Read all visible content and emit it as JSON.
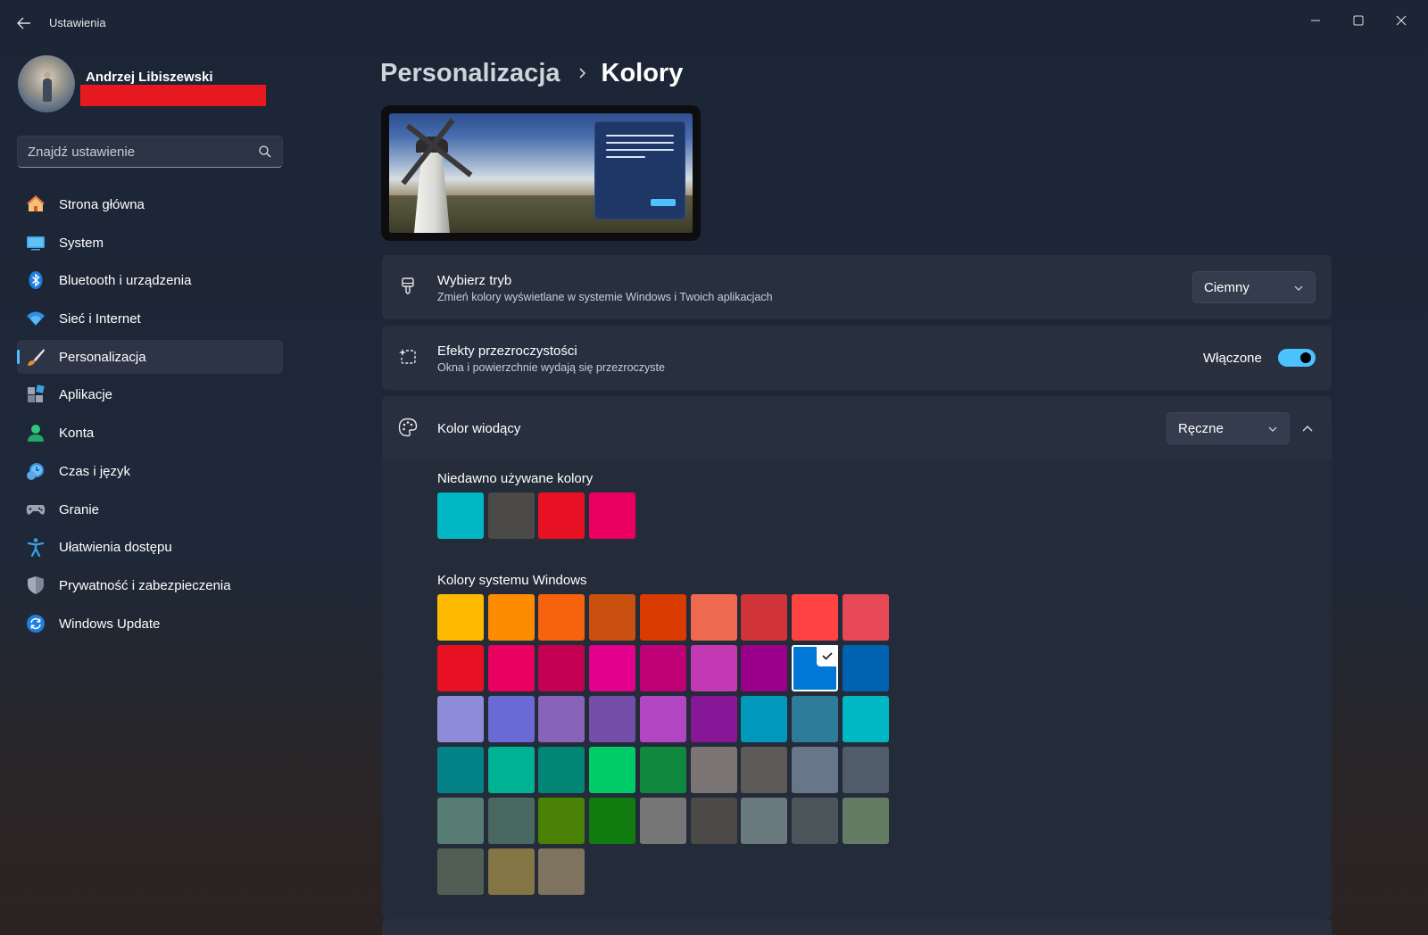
{
  "app": {
    "title": "Ustawienia"
  },
  "profile": {
    "name": "Andrzej Libiszewski"
  },
  "search": {
    "placeholder": "Znajdź ustawienie"
  },
  "nav": [
    {
      "label": "Strona główna",
      "icon": "home-icon"
    },
    {
      "label": "System",
      "icon": "monitor-icon"
    },
    {
      "label": "Bluetooth i urządzenia",
      "icon": "bluetooth-icon"
    },
    {
      "label": "Sieć i Internet",
      "icon": "wifi-icon"
    },
    {
      "label": "Personalizacja",
      "icon": "brush-icon",
      "active": true
    },
    {
      "label": "Aplikacje",
      "icon": "apps-icon"
    },
    {
      "label": "Konta",
      "icon": "person-icon"
    },
    {
      "label": "Czas i język",
      "icon": "clock-globe-icon"
    },
    {
      "label": "Granie",
      "icon": "gamepad-icon"
    },
    {
      "label": "Ułatwienia dostępu",
      "icon": "accessibility-icon"
    },
    {
      "label": "Prywatność i zabezpieczenia",
      "icon": "shield-icon"
    },
    {
      "label": "Windows Update",
      "icon": "update-icon"
    }
  ],
  "breadcrumb": {
    "parent": "Personalizacja",
    "current": "Kolory"
  },
  "mode": {
    "title": "Wybierz tryb",
    "subtitle": "Zmień kolory wyświetlane w systemie Windows i Twoich aplikacjach",
    "value": "Ciemny"
  },
  "transparency": {
    "title": "Efekty przezroczystości",
    "subtitle": "Okna i powierzchnie wydają się przezroczyste",
    "state_label": "Włączone",
    "on": true
  },
  "accent": {
    "title": "Kolor wiodący",
    "value": "Ręczne",
    "recent_title": "Niedawno używane kolory",
    "recent_colors": [
      "#00b7c3",
      "#4c4a48",
      "#e81123",
      "#ea005e"
    ],
    "system_title": "Kolory systemu Windows",
    "selected_color": "#0078d7",
    "system_colors": [
      [
        "#ffb900",
        "#ff8c00",
        "#f7630c",
        "#ca5010",
        "#da3b01",
        "#ef6950",
        "#d13438",
        "#ff4343",
        "#e74856"
      ],
      [
        "#e81123",
        "#ea005e",
        "#c30052",
        "#e3008c",
        "#bf0077",
        "#c239b3",
        "#9a0089",
        "#0078d7",
        "#0063b1"
      ],
      [
        "#8e8cd8",
        "#6b69d6",
        "#8764b8",
        "#744da9",
        "#b146c2",
        "#881798",
        "#0099bc",
        "#2d7d9a",
        "#00b7c3"
      ],
      [
        "#038387",
        "#00b294",
        "#018574",
        "#00cc6a",
        "#10893e",
        "#7a7574",
        "#5d5a58",
        "#68768a",
        "#515c6b"
      ],
      [
        "#567c73",
        "#486860",
        "#498205",
        "#107c10",
        "#767676",
        "#4c4a48",
        "#69797e",
        "#4a5459",
        "#647c64"
      ],
      [
        "#525e54",
        "#847545",
        "#7e735f"
      ]
    ]
  }
}
